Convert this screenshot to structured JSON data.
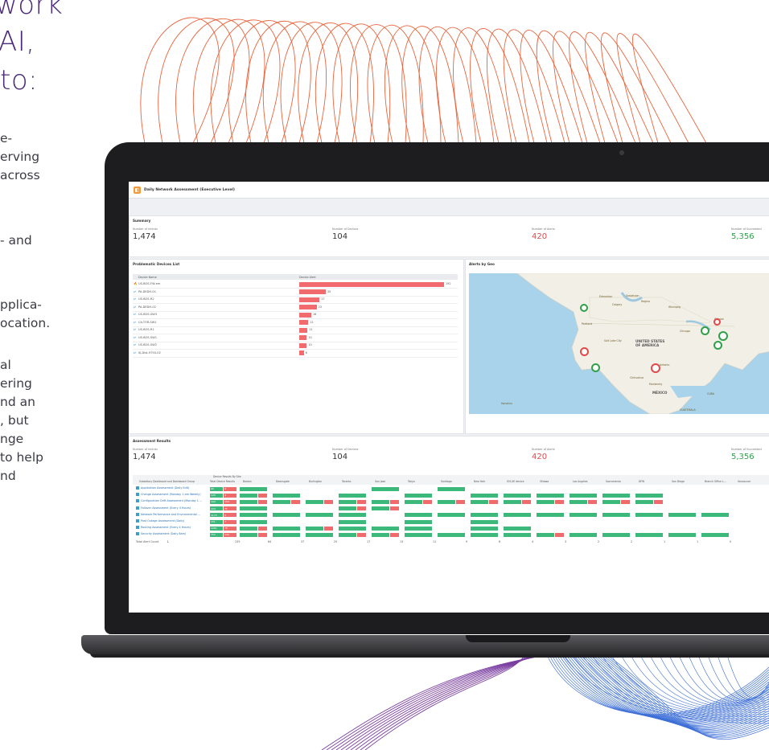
{
  "marketing": {
    "heading_lines": [
      "work",
      "AI,",
      "to:"
    ],
    "copy_fragments": [
      "e-",
      "erving",
      "across",
      "- and",
      "pplica-",
      "ocation.",
      "al",
      "ering",
      "nd an",
      ", but",
      "nge",
      "to help",
      "nd"
    ]
  },
  "dashboard": {
    "title": "Daily Network Assessment (Executive Level)",
    "summary": {
      "title": "Summary",
      "items": [
        {
          "label": "Number of Intents",
          "value": "1,474",
          "color": "default"
        },
        {
          "label": "Number of Devices",
          "value": "104",
          "color": "default"
        },
        {
          "label": "Number of Alerts",
          "value": "420",
          "color": "red"
        },
        {
          "label": "Number of Succeeded",
          "value": "5,356",
          "color": "green"
        }
      ]
    },
    "devices_panel": {
      "title": "Problematic Devices List",
      "col_name": "Device Name",
      "col_alert": "Device Alert",
      "devices": [
        {
          "name": "US-BOS-FW-em",
          "alerts": 192
        },
        {
          "name": "PA-DEDH-01",
          "alerts": 35
        },
        {
          "name": "US-BOS-R2",
          "alerts": 27
        },
        {
          "name": "PA-DEDH-02",
          "alerts": 23
        },
        {
          "name": "US-BOS-SW3",
          "alerts": 16
        },
        {
          "name": "CA-TOR-SW1",
          "alerts": 12
        },
        {
          "name": "US-BOS-R1",
          "alerts": 11
        },
        {
          "name": "US-BOS-SW1",
          "alerts": 10
        },
        {
          "name": "US-BOS-SW2",
          "alerts": 10
        },
        {
          "name": "SJ-Dist-9750-02",
          "alerts": 6
        }
      ]
    },
    "map_panel": {
      "title": "Alerts by Geo",
      "labels": {
        "country_usa": "UNITED STATES OF AMERICA",
        "country_mexico": "MÉXICO",
        "edmonton": "Edmonton",
        "calgary": "Calgary",
        "regina": "Regina",
        "saskatoon": "Saskatoon",
        "winnipeg": "Winnipeg",
        "chicago": "Chicago",
        "ottawa": "Ottawa",
        "salt_lake": "Salt Lake City",
        "san_antonio": "San Antonio",
        "monterrey": "Monterrey",
        "chihuahua": "Chihuahua",
        "portland": "Portland",
        "cuba": "CUBA",
        "guatemala": "GUATEMALA",
        "honolulu": "Honolulu"
      }
    },
    "assessment": {
      "title": "Assessment Results",
      "summary_items": [
        {
          "label": "Number of Intents",
          "value": "1,474",
          "color": "default"
        },
        {
          "label": "Number of Devices",
          "value": "104",
          "color": "default"
        },
        {
          "label": "Number of Alerts",
          "value": "420",
          "color": "red"
        },
        {
          "label": "Number of Succeeded",
          "value": "5,356",
          "color": "green"
        }
      ],
      "group_header": "Device Results By Site",
      "first_col_header": "Subsidiary Dashboard and Dashboard Group",
      "columns": [
        "Total Device Results",
        "Boston",
        "Deansgate",
        "Burlington",
        "Toronto",
        "San Jose",
        "Tokyo",
        "Santiago",
        "New York",
        "IOS-XE device",
        "Ottawa",
        "Los Angeles",
        "Sacramento",
        "DFW",
        "San Diego",
        "Branch Office L...",
        "Vancouver"
      ],
      "rows": [
        {
          "label": "Application Assessment (Daily Edit)",
          "green": 60,
          "red": 8
        },
        {
          "label": "Change Assessment (Monday 1 am Weekly)",
          "green": 126,
          "red": 4
        },
        {
          "label": "Configuration Drift Assessment (Monday 1 ...",
          "green": 194,
          "red": 104
        },
        {
          "label": "Failover Assessment (Every 4 Hours)",
          "green": 104,
          "red": 71
        },
        {
          "label": "Network Performance and Environmental ...",
          "green": 1173,
          "red": 6
        },
        {
          "label": "Post Outage Assessment (Daily)",
          "green": 151,
          "red": 7
        },
        {
          "label": "Routing Assessment (Every 4 Hours)",
          "green": 1261,
          "red": 76
        },
        {
          "label": "Security Assessment (Daily 8am)",
          "green": 752,
          "red": 144
        }
      ],
      "total_label": "Total Alert Count",
      "totals": [
        "235",
        "64",
        "37",
        "25",
        "17",
        "13",
        "11",
        "9",
        "8",
        "4",
        "3",
        "2",
        "2",
        "1",
        "1",
        "0"
      ]
    }
  }
}
